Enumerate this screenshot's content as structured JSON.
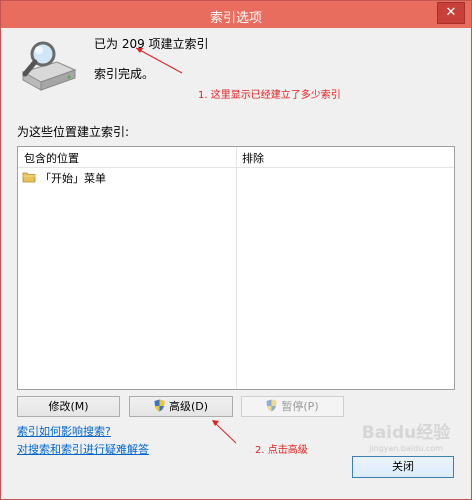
{
  "window": {
    "title": "索引选项",
    "close_glyph": "✕"
  },
  "summary": {
    "count_text": "已为 209 项建立索引",
    "status_text": "索引完成。"
  },
  "locations": {
    "section_label": "为这些位置建立索引:",
    "columns": [
      "包含的位置",
      "排除"
    ],
    "rows": [
      {
        "location": "「开始」菜单",
        "exclude": "",
        "icon": "folder-icon"
      }
    ]
  },
  "buttons": {
    "modify": "修改(M)",
    "advanced": "高级(D)",
    "pause": "暂停(P)",
    "close": "关闭"
  },
  "links": {
    "how_indexing": "索引如何影响搜索?",
    "troubleshoot": "对搜索和索引进行疑难解答"
  },
  "annotations": {
    "note_1": "1. 这里显示已经建立了多少索引",
    "note_2": "2. 点击高级",
    "color": "#e02020"
  },
  "watermark": {
    "main": "Baidu经验",
    "sub": "jingyan.baidu.com"
  },
  "colors": {
    "titlebar": "#e96d5f",
    "link": "#0066cc"
  }
}
